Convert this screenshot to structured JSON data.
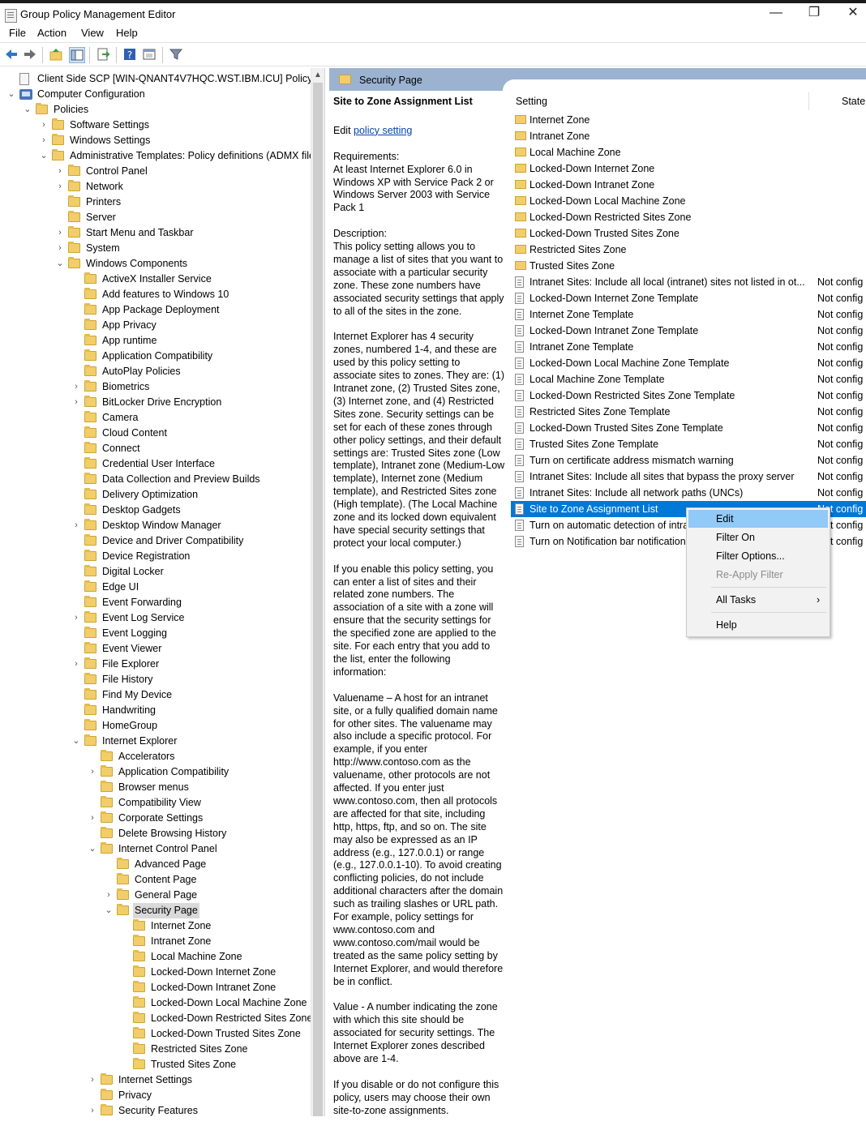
{
  "window": {
    "title": "Group Policy Management Editor",
    "minimize": "—",
    "restore": "❐",
    "close": "✕"
  },
  "menu": [
    "File",
    "Action",
    "View",
    "Help"
  ],
  "tree": [
    {
      "label": "Client Side SCP [WIN-QNANT4V7HQC.WST.IBM.ICU] Policy",
      "level": 0,
      "chev": "",
      "icon": "doc"
    },
    {
      "label": "Computer Configuration",
      "level": 0,
      "chev": "⌄",
      "icon": "pc"
    },
    {
      "label": "Policies",
      "level": 1,
      "chev": "⌄",
      "icon": "folder"
    },
    {
      "label": "Software Settings",
      "level": 2,
      "chev": "›",
      "icon": "folder"
    },
    {
      "label": "Windows Settings",
      "level": 2,
      "chev": "›",
      "icon": "folder"
    },
    {
      "label": "Administrative Templates: Policy definitions (ADMX files) retrieved from the local computer",
      "level": 2,
      "chev": "⌄",
      "icon": "folder"
    },
    {
      "label": "Control Panel",
      "level": 3,
      "chev": "›",
      "icon": "folder"
    },
    {
      "label": "Network",
      "level": 3,
      "chev": "›",
      "icon": "folder"
    },
    {
      "label": "Printers",
      "level": 3,
      "chev": "",
      "icon": "folder"
    },
    {
      "label": "Server",
      "level": 3,
      "chev": "",
      "icon": "folder"
    },
    {
      "label": "Start Menu and Taskbar",
      "level": 3,
      "chev": "›",
      "icon": "folder"
    },
    {
      "label": "System",
      "level": 3,
      "chev": "›",
      "icon": "folder"
    },
    {
      "label": "Windows Components",
      "level": 3,
      "chev": "⌄",
      "icon": "folder"
    },
    {
      "label": "ActiveX Installer Service",
      "level": 4,
      "chev": "",
      "icon": "folder"
    },
    {
      "label": "Add features to Windows 10",
      "level": 4,
      "chev": "",
      "icon": "folder"
    },
    {
      "label": "App Package Deployment",
      "level": 4,
      "chev": "",
      "icon": "folder"
    },
    {
      "label": "App Privacy",
      "level": 4,
      "chev": "",
      "icon": "folder"
    },
    {
      "label": "App runtime",
      "level": 4,
      "chev": "",
      "icon": "folder"
    },
    {
      "label": "Application Compatibility",
      "level": 4,
      "chev": "",
      "icon": "folder"
    },
    {
      "label": "AutoPlay Policies",
      "level": 4,
      "chev": "",
      "icon": "folder"
    },
    {
      "label": "Biometrics",
      "level": 4,
      "chev": "›",
      "icon": "folder"
    },
    {
      "label": "BitLocker Drive Encryption",
      "level": 4,
      "chev": "›",
      "icon": "folder"
    },
    {
      "label": "Camera",
      "level": 4,
      "chev": "",
      "icon": "folder"
    },
    {
      "label": "Cloud Content",
      "level": 4,
      "chev": "",
      "icon": "folder"
    },
    {
      "label": "Connect",
      "level": 4,
      "chev": "",
      "icon": "folder"
    },
    {
      "label": "Credential User Interface",
      "level": 4,
      "chev": "",
      "icon": "folder"
    },
    {
      "label": "Data Collection and Preview Builds",
      "level": 4,
      "chev": "",
      "icon": "folder"
    },
    {
      "label": "Delivery Optimization",
      "level": 4,
      "chev": "",
      "icon": "folder"
    },
    {
      "label": "Desktop Gadgets",
      "level": 4,
      "chev": "",
      "icon": "folder"
    },
    {
      "label": "Desktop Window Manager",
      "level": 4,
      "chev": "›",
      "icon": "folder"
    },
    {
      "label": "Device and Driver Compatibility",
      "level": 4,
      "chev": "",
      "icon": "folder"
    },
    {
      "label": "Device Registration",
      "level": 4,
      "chev": "",
      "icon": "folder"
    },
    {
      "label": "Digital Locker",
      "level": 4,
      "chev": "",
      "icon": "folder"
    },
    {
      "label": "Edge UI",
      "level": 4,
      "chev": "",
      "icon": "folder"
    },
    {
      "label": "Event Forwarding",
      "level": 4,
      "chev": "",
      "icon": "folder"
    },
    {
      "label": "Event Log Service",
      "level": 4,
      "chev": "›",
      "icon": "folder"
    },
    {
      "label": "Event Logging",
      "level": 4,
      "chev": "",
      "icon": "folder"
    },
    {
      "label": "Event Viewer",
      "level": 4,
      "chev": "",
      "icon": "folder"
    },
    {
      "label": "File Explorer",
      "level": 4,
      "chev": "›",
      "icon": "folder"
    },
    {
      "label": "File History",
      "level": 4,
      "chev": "",
      "icon": "folder"
    },
    {
      "label": "Find My Device",
      "level": 4,
      "chev": "",
      "icon": "folder"
    },
    {
      "label": "Handwriting",
      "level": 4,
      "chev": "",
      "icon": "folder"
    },
    {
      "label": "HomeGroup",
      "level": 4,
      "chev": "",
      "icon": "folder"
    },
    {
      "label": "Internet Explorer",
      "level": 4,
      "chev": "⌄",
      "icon": "folder"
    },
    {
      "label": "Accelerators",
      "level": 5,
      "chev": "",
      "icon": "folder"
    },
    {
      "label": "Application Compatibility",
      "level": 5,
      "chev": "›",
      "icon": "folder"
    },
    {
      "label": "Browser menus",
      "level": 5,
      "chev": "",
      "icon": "folder"
    },
    {
      "label": "Compatibility View",
      "level": 5,
      "chev": "",
      "icon": "folder"
    },
    {
      "label": "Corporate Settings",
      "level": 5,
      "chev": "›",
      "icon": "folder"
    },
    {
      "label": "Delete Browsing History",
      "level": 5,
      "chev": "",
      "icon": "folder"
    },
    {
      "label": "Internet Control Panel",
      "level": 5,
      "chev": "⌄",
      "icon": "folder"
    },
    {
      "label": "Advanced Page",
      "level": 6,
      "chev": "",
      "icon": "folder"
    },
    {
      "label": "Content Page",
      "level": 6,
      "chev": "",
      "icon": "folder"
    },
    {
      "label": "General Page",
      "level": 6,
      "chev": "›",
      "icon": "folder"
    },
    {
      "label": "Security Page",
      "level": 6,
      "chev": "⌄",
      "icon": "folder",
      "selected": true
    },
    {
      "label": "Internet Zone",
      "level": 7,
      "chev": "",
      "icon": "folder"
    },
    {
      "label": "Intranet Zone",
      "level": 7,
      "chev": "",
      "icon": "folder"
    },
    {
      "label": "Local Machine Zone",
      "level": 7,
      "chev": "",
      "icon": "folder"
    },
    {
      "label": "Locked-Down Internet Zone",
      "level": 7,
      "chev": "",
      "icon": "folder"
    },
    {
      "label": "Locked-Down Intranet Zone",
      "level": 7,
      "chev": "",
      "icon": "folder"
    },
    {
      "label": "Locked-Down Local Machine Zone",
      "level": 7,
      "chev": "",
      "icon": "folder"
    },
    {
      "label": "Locked-Down Restricted Sites Zone",
      "level": 7,
      "chev": "",
      "icon": "folder"
    },
    {
      "label": "Locked-Down Trusted Sites Zone",
      "level": 7,
      "chev": "",
      "icon": "folder"
    },
    {
      "label": "Restricted Sites Zone",
      "level": 7,
      "chev": "",
      "icon": "folder"
    },
    {
      "label": "Trusted Sites Zone",
      "level": 7,
      "chev": "",
      "icon": "folder"
    },
    {
      "label": "Internet Settings",
      "level": 5,
      "chev": "›",
      "icon": "folder"
    },
    {
      "label": "Privacy",
      "level": 5,
      "chev": "",
      "icon": "folder"
    },
    {
      "label": "Security Features",
      "level": 5,
      "chev": "›",
      "icon": "folder"
    }
  ],
  "header": {
    "title": "Security Page"
  },
  "description": {
    "heading": "Site to Zone Assignment List",
    "edit_prefix": "Edit ",
    "edit_link": "policy setting",
    "paragraphs": [
      "Requirements:\nAt least Internet Explorer 6.0 in Windows XP with Service Pack 2 or Windows Server 2003 with Service Pack 1",
      "Description:\nThis policy setting allows you to manage a list of sites that you want to associate with a particular security zone. These zone numbers have associated security settings that apply to all of the sites in the zone.",
      "Internet Explorer has 4 security zones, numbered 1-4, and these are used by this policy setting to associate sites to zones. They are: (1) Intranet zone, (2) Trusted Sites zone, (3) Internet zone, and (4) Restricted Sites zone. Security settings can be set for each of these zones through other policy settings, and their default settings are: Trusted Sites zone (Low template), Intranet zone (Medium-Low template), Internet zone (Medium template), and Restricted Sites zone (High template). (The Local Machine zone and its locked down equivalent have special security settings that protect your local computer.)",
      "If you enable this policy setting, you can enter a list of sites and their related zone numbers. The association of a site with a zone will ensure that the security settings for the specified zone are applied to the site.  For each entry that you add to the list, enter the following information:",
      "Valuename – A host for an intranet site, or a fully qualified domain name for other sites. The valuename may also include a specific protocol. For example, if you enter http://www.contoso.com as the valuename, other protocols are not affected. If you enter just www.contoso.com, then all protocols are affected for that site, including http, https, ftp, and so on. The site may also be expressed as an IP address (e.g., 127.0.0.1) or range (e.g., 127.0.0.1-10). To avoid creating conflicting policies, do not include additional characters after the domain such as trailing slashes or URL path. For example, policy settings for www.contoso.com and www.contoso.com/mail would be treated as the same policy setting by Internet Explorer, and would therefore be in conflict.",
      "Value - A number indicating the zone with which this site should be associated for security settings. The Internet Explorer zones described above are 1-4.",
      "If you disable or do not configure this policy, users may choose their own site-to-zone assignments."
    ]
  },
  "list": {
    "columns": {
      "setting": "Setting",
      "state": "State"
    },
    "rows": [
      {
        "name": "Internet Zone",
        "state": "",
        "icon": "folder"
      },
      {
        "name": "Intranet Zone",
        "state": "",
        "icon": "folder"
      },
      {
        "name": "Local Machine Zone",
        "state": "",
        "icon": "folder"
      },
      {
        "name": "Locked-Down Internet Zone",
        "state": "",
        "icon": "folder"
      },
      {
        "name": "Locked-Down Intranet Zone",
        "state": "",
        "icon": "folder"
      },
      {
        "name": "Locked-Down Local Machine Zone",
        "state": "",
        "icon": "folder"
      },
      {
        "name": "Locked-Down Restricted Sites Zone",
        "state": "",
        "icon": "folder"
      },
      {
        "name": "Locked-Down Trusted Sites Zone",
        "state": "",
        "icon": "folder"
      },
      {
        "name": "Restricted Sites Zone",
        "state": "",
        "icon": "folder"
      },
      {
        "name": "Trusted Sites Zone",
        "state": "",
        "icon": "folder"
      },
      {
        "name": "Intranet Sites: Include all local (intranet) sites not listed in ot...",
        "state": "Not config",
        "icon": "setting"
      },
      {
        "name": "Locked-Down Internet Zone Template",
        "state": "Not config",
        "icon": "setting"
      },
      {
        "name": "Internet Zone Template",
        "state": "Not config",
        "icon": "setting"
      },
      {
        "name": "Locked-Down Intranet Zone Template",
        "state": "Not config",
        "icon": "setting"
      },
      {
        "name": "Intranet Zone Template",
        "state": "Not config",
        "icon": "setting"
      },
      {
        "name": "Locked-Down Local Machine Zone Template",
        "state": "Not config",
        "icon": "setting"
      },
      {
        "name": "Local Machine Zone Template",
        "state": "Not config",
        "icon": "setting"
      },
      {
        "name": "Locked-Down Restricted Sites Zone Template",
        "state": "Not config",
        "icon": "setting"
      },
      {
        "name": "Restricted Sites Zone Template",
        "state": "Not config",
        "icon": "setting"
      },
      {
        "name": "Locked-Down Trusted Sites Zone Template",
        "state": "Not config",
        "icon": "setting"
      },
      {
        "name": "Trusted Sites Zone Template",
        "state": "Not config",
        "icon": "setting"
      },
      {
        "name": "Turn on certificate address mismatch warning",
        "state": "Not config",
        "icon": "setting"
      },
      {
        "name": "Intranet Sites: Include all sites that bypass the proxy server",
        "state": "Not config",
        "icon": "setting"
      },
      {
        "name": "Intranet Sites: Include all network paths (UNCs)",
        "state": "Not config",
        "icon": "setting"
      },
      {
        "name": "Site to Zone Assignment List",
        "state": "Not config",
        "icon": "setting",
        "selected": true
      },
      {
        "name": "Turn on automatic detection of intranet",
        "state": "Not config",
        "icon": "setting"
      },
      {
        "name": "Turn on Notification bar notification",
        "state": "Not config",
        "icon": "setting"
      }
    ]
  },
  "context_menu": {
    "items": [
      {
        "label": "Edit",
        "highlighted": true
      },
      {
        "label": "Filter On"
      },
      {
        "label": "Filter Options..."
      },
      {
        "label": "Re-Apply Filter",
        "disabled": true
      },
      {
        "sep": true
      },
      {
        "label": "All Tasks",
        "submenu": true
      },
      {
        "sep": true
      },
      {
        "label": "Help"
      }
    ],
    "submenu_arrow": "›"
  },
  "colors": {
    "selection": "#0078d7",
    "menu_highlight": "#91c9f7",
    "header_band": "#9bb3d1",
    "link": "#0645ad"
  }
}
